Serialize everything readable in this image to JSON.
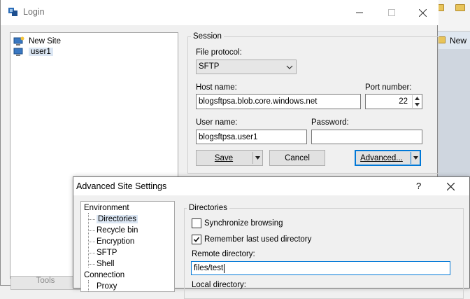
{
  "login": {
    "title": "Login",
    "sites": [
      {
        "label": "New Site"
      },
      {
        "label": "user1"
      }
    ],
    "session": {
      "legend": "Session",
      "file_protocol_label": "File protocol:",
      "file_protocol_value": "SFTP",
      "host_label": "Host name:",
      "host_value": "blogsftpsa.blob.core.windows.net",
      "port_label": "Port number:",
      "port_value": "22",
      "user_label": "User name:",
      "user_value": "blogsftpsa.user1",
      "password_label": "Password:",
      "password_value": ""
    },
    "buttons": {
      "save": "Save",
      "cancel": "Cancel",
      "advanced": "Advanced...",
      "tools": "Tools"
    }
  },
  "background": {
    "new_label": "New"
  },
  "advanced": {
    "title": "Advanced Site Settings",
    "help": "?",
    "tree": {
      "environment": "Environment",
      "directories": "Directories",
      "recycle_bin": "Recycle bin",
      "encryption": "Encryption",
      "sftp": "SFTP",
      "shell": "Shell",
      "connection": "Connection",
      "proxy": "Proxy"
    },
    "directories": {
      "legend": "Directories",
      "sync_label": "Synchronize browsing",
      "sync_checked": false,
      "remember_label": "Remember last used directory",
      "remember_checked": true,
      "remote_label": "Remote directory:",
      "remote_value": "files/test",
      "local_label": "Local directory:"
    }
  },
  "colors": {
    "selection": "#dbe6f3",
    "focus_border": "#0078d7",
    "window_bg": "#f0f0f0"
  }
}
